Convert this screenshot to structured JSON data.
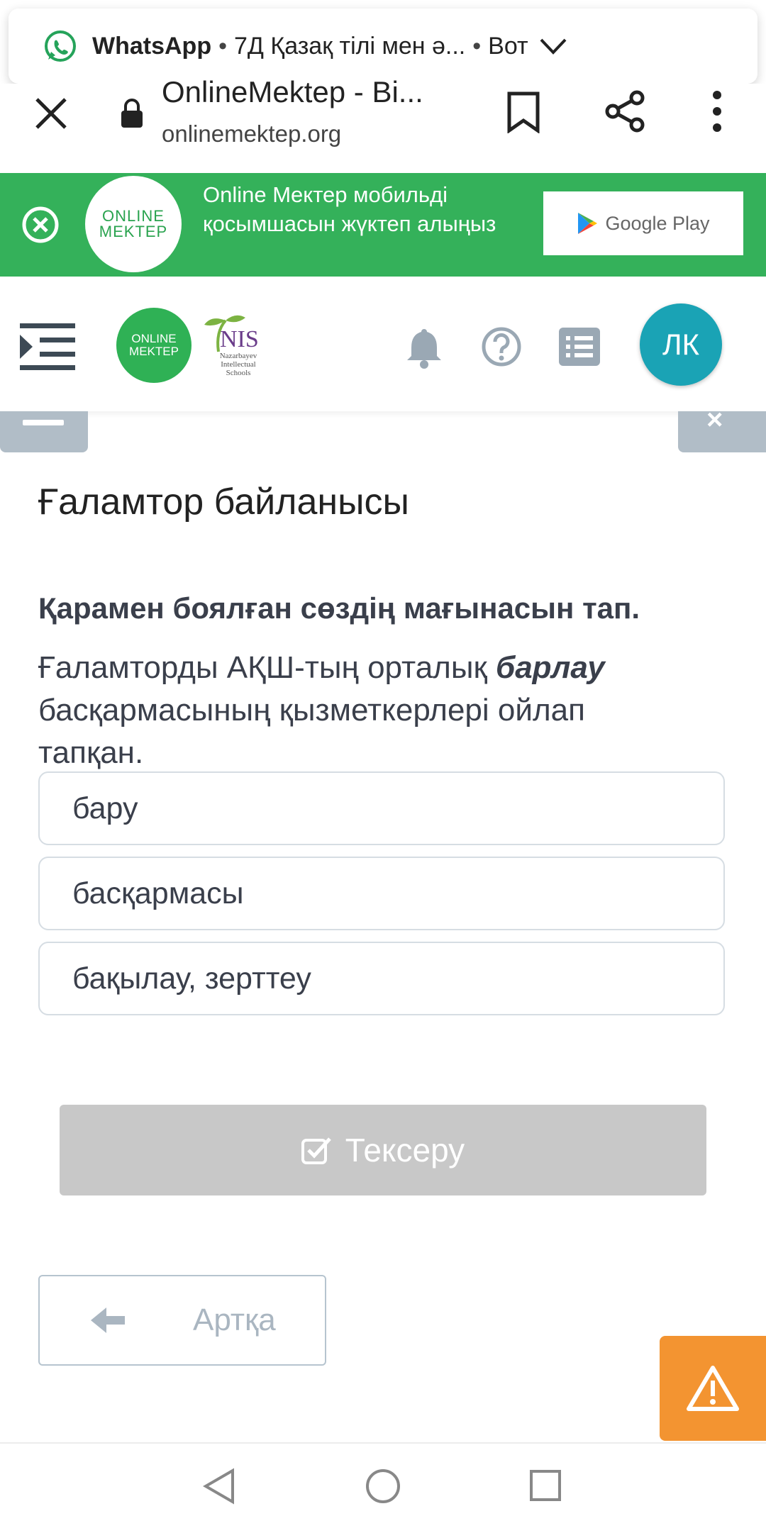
{
  "notification": {
    "app": "WhatsApp",
    "message": "7Д Қазақ тілі мен ә...",
    "sender": "Вот"
  },
  "browser": {
    "title": "OnlineMektep - Bi...",
    "url": "onlinemektep.org"
  },
  "banner": {
    "logo_line1": "ONLINE",
    "logo_line2": "MEKTEP",
    "text": "Online Mектер мобильді қосымшасын жүктеп алыңыз",
    "store_label": "Google Play"
  },
  "header": {
    "logo_line1": "ONLINE",
    "logo_line2": "MEKTEP",
    "nis_name": "NIS",
    "nis_subtitle": "Nazarbayev Intellectual Schools",
    "avatar_initials": "ЛК"
  },
  "content": {
    "page_title": "Ғаламтор байланысы",
    "question": "Қарамен боялған сөздің мағынасын тап.",
    "sentence_before": "Ғаламторды АҚШ-тың орталық ",
    "sentence_highlight": "барлау",
    "sentence_after": " басқармасының қызметкерлері ойлап тапқан.",
    "options": [
      "бару",
      "басқармасы",
      "бақылау, зерттеу"
    ],
    "check_label": "Тексеру",
    "back_label": "Артқа"
  },
  "colors": {
    "banner_green": "#34b15a",
    "avatar_teal": "#1aa3b5",
    "warning_orange": "#f39431",
    "disabled_gray": "#c8c8c8"
  }
}
